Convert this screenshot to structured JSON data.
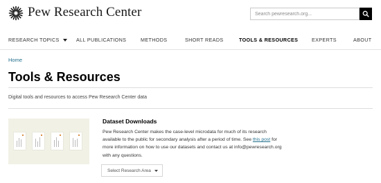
{
  "header": {
    "logo_text": "Pew Research Center",
    "search_placeholder": "Search pewresearch.org...",
    "search_icon": "search-icon"
  },
  "nav": {
    "items": [
      {
        "label": "RESEARCH TOPICS",
        "has_caret": true
      },
      {
        "label": "ALL PUBLICATIONS"
      },
      {
        "label": "METHODS"
      },
      {
        "label": "SHORT READS"
      },
      {
        "label": "TOOLS & RESOURCES",
        "active": true
      },
      {
        "label": "EXPERTS"
      },
      {
        "label": "ABOUT"
      }
    ]
  },
  "breadcrumb": "Home",
  "page": {
    "title": "Tools & Resources",
    "subtitle": "Digital tools and resources to access Pew Research Center data"
  },
  "card": {
    "title": "Dataset Downloads",
    "body_before": "Pew Research Center makes the case-level microdata for much of its research available to the public for secondary analysis after a period of time. See ",
    "link_text": "this post",
    "body_after": " for more information on how to use our datasets and contact us at info@pewresearch.org with any questions.",
    "select_label": "Select Research Area"
  },
  "colors": {
    "accent_link": "#1f6e8c",
    "thumbnail_bg": "#f2f1e6",
    "document_dot": "#d98a3c"
  }
}
